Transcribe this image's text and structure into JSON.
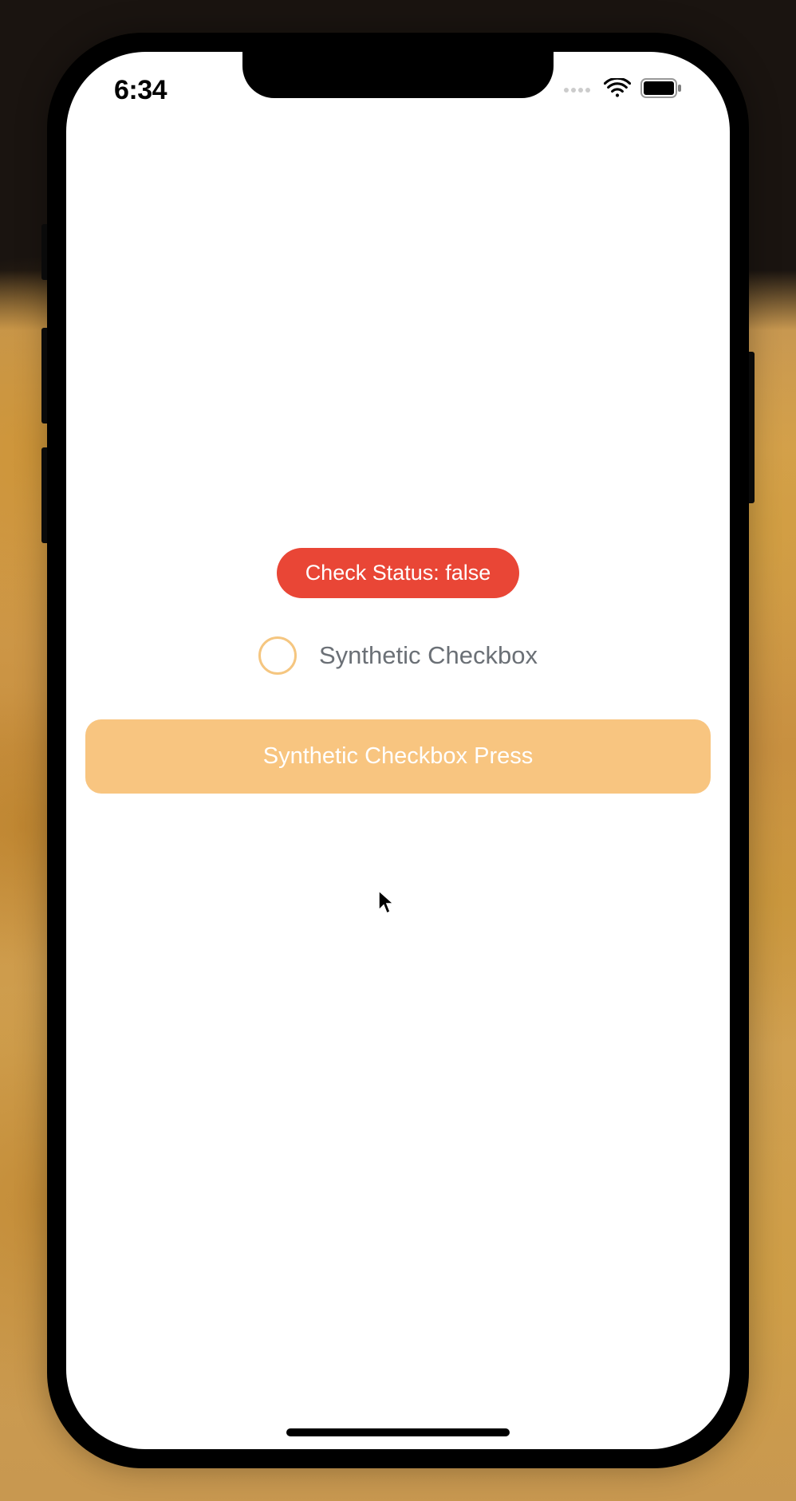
{
  "status_bar": {
    "time": "6:34"
  },
  "main": {
    "status_pill_label": "Check Status: false",
    "checkbox_label": "Synthetic Checkbox",
    "press_button_label": "Synthetic Checkbox Press"
  },
  "colors": {
    "accent_red": "#e94636",
    "accent_orange": "#f8c580",
    "text_gray": "#6b7076"
  }
}
